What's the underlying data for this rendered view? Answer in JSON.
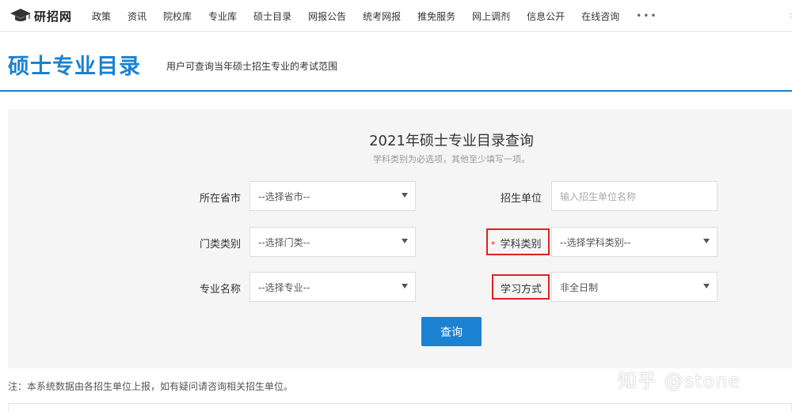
{
  "nav": {
    "logo_text": "研招网",
    "items": [
      "政策",
      "资讯",
      "院校库",
      "专业库",
      "硕士目录",
      "网报公告",
      "统考网报",
      "推免服务",
      "网上调剂",
      "信息公开",
      "在线咨询"
    ],
    "more": "•••"
  },
  "header": {
    "title": "硕士专业目录",
    "subtitle": "用户可查询当年硕士招生专业的考试范围"
  },
  "form": {
    "title": "2021年硕士专业目录查询",
    "hint": "学科类别为必选项，其他至少填写一项。",
    "province": {
      "label": "所在省市",
      "value": "--选择省市--"
    },
    "unit": {
      "label": "招生单位",
      "placeholder": "输入招生单位名称"
    },
    "category": {
      "label": "门类类别",
      "value": "--选择门类--"
    },
    "discipline": {
      "label": "学科类别",
      "required_mark": "*",
      "value": "--选择学科类别--"
    },
    "major": {
      "label": "专业名称",
      "value": "--选择专业--"
    },
    "study_mode": {
      "label": "学习方式",
      "value": "非全日制"
    },
    "submit_label": "查询"
  },
  "footer": {
    "note": "注：本系统数据由各招生单位上报，如有疑问请咨询相关招生单位。"
  },
  "watermark": "知乎 @stone",
  "colors": {
    "accent": "#1b82d1",
    "highlight": "#e02020",
    "panel_bg": "#f5f5f5"
  }
}
